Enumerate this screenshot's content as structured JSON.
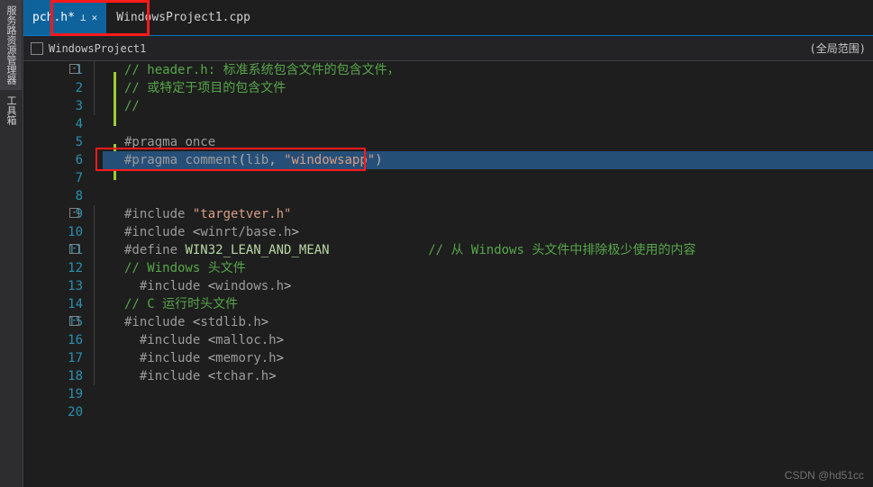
{
  "sidebar": {
    "items": [
      "服务路资源管理器",
      "工具箱"
    ]
  },
  "tabs": {
    "items": [
      {
        "label": "pch.h*",
        "active": true,
        "pinned": true,
        "closable": true
      },
      {
        "label": "WindowsProject1.cpp",
        "active": false
      }
    ]
  },
  "nav": {
    "project": "WindowsProject1",
    "scope": "(全局范围)"
  },
  "editor": {
    "lines": [
      {
        "num": 1,
        "fold": "-",
        "segs": [
          {
            "t": "// ",
            "c": "c-comment"
          },
          {
            "t": "header.h: 标准系统包含文件的包含文件，",
            "c": "c-comment"
          }
        ]
      },
      {
        "num": 2,
        "segs": [
          {
            "t": "// 或特定于项目的包含文件",
            "c": "c-comment"
          }
        ]
      },
      {
        "num": 3,
        "segs": [
          {
            "t": "//",
            "c": "c-comment"
          }
        ]
      },
      {
        "num": 4,
        "segs": []
      },
      {
        "num": 5,
        "changed": true,
        "segs": [
          {
            "t": "#pragma",
            "c": "c-pre"
          },
          {
            "t": " ",
            "c": ""
          },
          {
            "t": "once",
            "c": "c-pre"
          }
        ]
      },
      {
        "num": 6,
        "changed": true,
        "selected": true,
        "segs": [
          {
            "t": "#pragma",
            "c": "c-pre"
          },
          {
            "t": " ",
            "c": ""
          },
          {
            "t": "comment",
            "c": "c-pre"
          },
          {
            "t": "(",
            "c": "c-op"
          },
          {
            "t": "lib",
            "c": "c-pre"
          },
          {
            "t": ", ",
            "c": "c-op"
          },
          {
            "t": "\"windowsapp\"",
            "c": "c-str"
          },
          {
            "t": ")",
            "c": "c-op"
          }
        ]
      },
      {
        "num": 7,
        "changed": true,
        "segs": []
      },
      {
        "num": 8,
        "segs": []
      },
      {
        "num": 9,
        "fold": "-",
        "changed": true,
        "segs": [
          {
            "t": "#include",
            "c": "c-pre"
          },
          {
            "t": " ",
            "c": ""
          },
          {
            "t": "\"targetver.h\"",
            "c": "c-str"
          }
        ]
      },
      {
        "num": 10,
        "changed": true,
        "segs": [
          {
            "t": "#include",
            "c": "c-pre"
          },
          {
            "t": " ",
            "c": ""
          },
          {
            "t": "<",
            "c": "c-op"
          },
          {
            "t": "winrt/base.h",
            "c": "c-pre"
          },
          {
            "t": ">",
            "c": "c-op"
          }
        ]
      },
      {
        "num": 11,
        "fold": "-",
        "segs": [
          {
            "t": "#define",
            "c": "c-pre"
          },
          {
            "t": " ",
            "c": ""
          },
          {
            "t": "WIN32_LEAN_AND_MEAN",
            "c": "c-macro"
          },
          {
            "t": "             ",
            "c": ""
          },
          {
            "t": "// 从 Windows 头文件中排除极少使用的内容",
            "c": "c-comment"
          }
        ]
      },
      {
        "num": 12,
        "segs": [
          {
            "t": "// Windows 头文件",
            "c": "c-comment"
          }
        ]
      },
      {
        "num": 13,
        "segs": [
          {
            "t": "  ",
            "c": ""
          },
          {
            "t": "#include",
            "c": "c-pre"
          },
          {
            "t": " ",
            "c": ""
          },
          {
            "t": "<",
            "c": "c-op"
          },
          {
            "t": "windows.h",
            "c": "c-pre"
          },
          {
            "t": ">",
            "c": "c-op"
          }
        ]
      },
      {
        "num": 14,
        "segs": [
          {
            "t": "// C 运行时头文件",
            "c": "c-comment"
          }
        ]
      },
      {
        "num": 15,
        "fold": "-",
        "segs": [
          {
            "t": "#include",
            "c": "c-pre"
          },
          {
            "t": " ",
            "c": ""
          },
          {
            "t": "<",
            "c": "c-op"
          },
          {
            "t": "stdlib.h",
            "c": "c-pre"
          },
          {
            "t": ">",
            "c": "c-op"
          }
        ]
      },
      {
        "num": 16,
        "segs": [
          {
            "t": "  ",
            "c": ""
          },
          {
            "t": "#include",
            "c": "c-pre"
          },
          {
            "t": " ",
            "c": ""
          },
          {
            "t": "<",
            "c": "c-op"
          },
          {
            "t": "malloc.h",
            "c": "c-pre"
          },
          {
            "t": ">",
            "c": "c-op"
          }
        ]
      },
      {
        "num": 17,
        "segs": [
          {
            "t": "  ",
            "c": ""
          },
          {
            "t": "#include",
            "c": "c-pre"
          },
          {
            "t": " ",
            "c": ""
          },
          {
            "t": "<",
            "c": "c-op"
          },
          {
            "t": "memory.h",
            "c": "c-pre"
          },
          {
            "t": ">",
            "c": "c-op"
          }
        ]
      },
      {
        "num": 18,
        "segs": [
          {
            "t": "  ",
            "c": ""
          },
          {
            "t": "#include",
            "c": "c-pre"
          },
          {
            "t": " ",
            "c": ""
          },
          {
            "t": "<",
            "c": "c-op"
          },
          {
            "t": "tchar.h",
            "c": "c-pre"
          },
          {
            "t": ">",
            "c": "c-op"
          }
        ]
      },
      {
        "num": 19,
        "segs": []
      },
      {
        "num": 20,
        "segs": []
      }
    ]
  },
  "watermark": "CSDN @hd51cc"
}
